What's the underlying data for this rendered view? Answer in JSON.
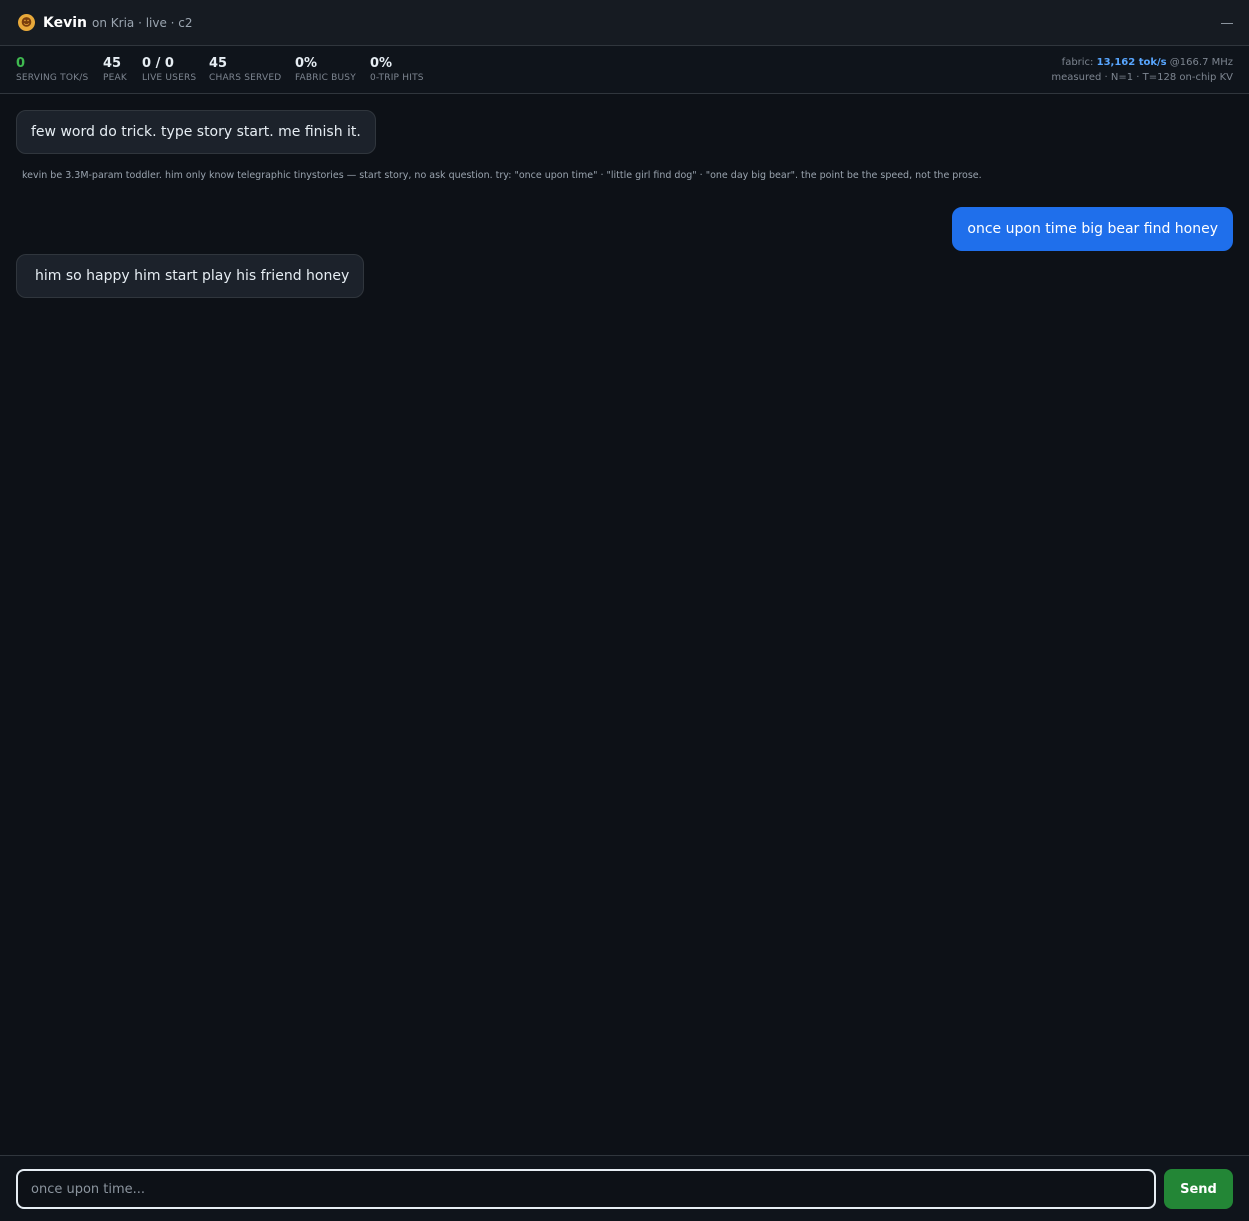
{
  "header": {
    "avatar_icon": "toddler-face-icon",
    "name": "Kevin",
    "subtitle": "on Kria · live · c2"
  },
  "stats": [
    {
      "value": "0",
      "label": "SERVING TOK/S"
    },
    {
      "value": "45",
      "label": "PEAK"
    },
    {
      "value": "0 / 0",
      "label": "LIVE USERS"
    },
    {
      "value": "45",
      "label": "CHARS SERVED"
    },
    {
      "value": "0%",
      "label": "FABRIC BUSY"
    },
    {
      "value": "0%",
      "label": "0-TRIP HITS"
    }
  ],
  "fabric": {
    "prefix": "fabric:",
    "rate": "13,162 tok/s",
    "clock": "@166.7 MHz",
    "line2": "measured · N=1 · T=128 on-chip KV"
  },
  "messages": [
    {
      "role": "bot",
      "text": "few word do trick. type story start. me finish it."
    },
    {
      "role": "user",
      "text": "once upon time big bear find honey"
    },
    {
      "role": "bot",
      "text": "him so happy him start play his friend honey"
    }
  ],
  "hint": "kevin be 3.3M-param toddler. him only know telegraphic tinystories — start story, no ask question. try: \"once upon time\" · \"little girl find dog\" · \"one day big bear\". the point be the speed, not the prose.",
  "composer": {
    "placeholder": "once upon time...",
    "send_label": "Send"
  },
  "colors": {
    "background": "#0d1117",
    "user_bubble": "#1f6feb",
    "send_button": "#238636",
    "serving_value": "#3fb950",
    "fabric_rate": "#58a6ff"
  }
}
